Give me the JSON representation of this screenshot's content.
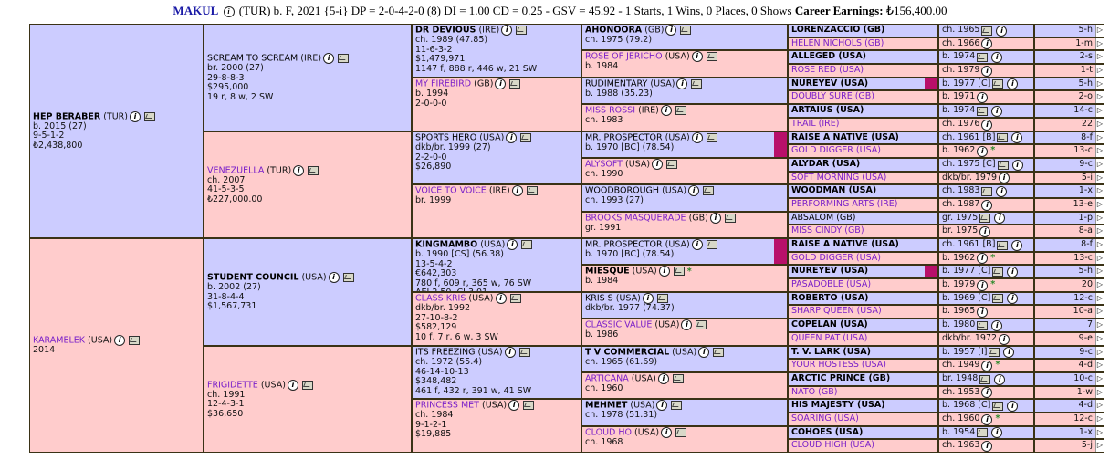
{
  "header": {
    "name": "MAKUL",
    "info": "(TUR) b. F, 2021 {5-i} DP = 2-0-4-2-0 (8) DI = 1.00  CD = 0.25 - GSV = 45.92 - 1 Starts, 1 Wins, 0 Places, 0 Shows",
    "earn_label": "Career Earnings:",
    "earn_value": "₺156,400.00"
  },
  "gen1": [
    {
      "name": "HEP BERABER",
      "suffix": "(TUR)",
      "lines": [
        "b. 2015 (27)",
        "9-5-1-2",
        "₺2,438,800"
      ],
      "sex": "male",
      "bold": true
    },
    {
      "name": "KARAMELEK",
      "suffix": "(USA)",
      "lines": [
        "2014"
      ],
      "sex": "female",
      "bold": false
    }
  ],
  "gen2": [
    {
      "name": "SCREAM TO SCREAM",
      "suffix": "(IRE)",
      "lines": [
        "br. 2000 (27)",
        "29-8-8-3",
        "$295,000",
        "19 r, 8 w, 2 SW"
      ],
      "sex": "male",
      "bold": false
    },
    {
      "name": "VENEZUELLA",
      "suffix": "(TUR)",
      "lines": [
        "ch. 2007",
        "41-5-3-5",
        "₺227,000.00"
      ],
      "sex": "female",
      "bold": false
    },
    {
      "name": "STUDENT COUNCIL",
      "suffix": "(USA)",
      "lines": [
        "b. 2002 (27)",
        "31-8-4-4",
        "$1,567,731"
      ],
      "sex": "male",
      "bold": true
    },
    {
      "name": "FRIGIDETTE",
      "suffix": "(USA)",
      "lines": [
        "ch. 1991",
        "12-4-3-1",
        "$36,650"
      ],
      "sex": "female",
      "bold": false
    }
  ],
  "gen3": [
    {
      "name": "DR DEVIOUS",
      "suffix": "(IRE)",
      "lines": [
        "ch. 1989 (47.85)",
        "11-6-3-2",
        "$1,479,971",
        "1147 f, 888 r, 446 w, 21 SW"
      ],
      "sex": "male",
      "bold": true
    },
    {
      "name": "MY FIREBIRD",
      "suffix": "(GB)",
      "lines": [
        "b. 1994",
        "2-0-0-0"
      ],
      "sex": "female",
      "bold": false
    },
    {
      "name": "SPORTS HERO",
      "suffix": "(USA)",
      "lines": [
        "dkb/br. 1999 (27)",
        "2-2-0-0",
        "$26,890"
      ],
      "sex": "male",
      "bold": false
    },
    {
      "name": "VOICE TO VOICE",
      "suffix": "(IRE)",
      "lines": [
        "br. 1999"
      ],
      "sex": "female",
      "bold": false
    },
    {
      "name": "KINGMAMBO",
      "suffix": "(USA)",
      "lines": [
        "b. 1990 [CS] (56.38)",
        "13-5-4-2",
        "€642,303",
        "780 f, 609 r, 365 w, 76 SW",
        "AEI 2.50, CI 3.01"
      ],
      "sex": "male",
      "bold": true
    },
    {
      "name": "CLASS KRIS",
      "suffix": "(USA)",
      "lines": [
        "dkb/br. 1992",
        "27-10-8-2",
        "$582,129",
        "10 f, 7 r, 6 w, 3 SW"
      ],
      "sex": "female",
      "bold": false
    },
    {
      "name": "ITS FREEZING",
      "suffix": "(USA)",
      "lines": [
        "ch. 1972 (55.4)",
        "46-14-10-13",
        "$348,482",
        "461 f, 432 r, 391 w, 41 SW"
      ],
      "sex": "male",
      "bold": false
    },
    {
      "name": "PRINCESS MET",
      "suffix": "(USA)",
      "lines": [
        "ch. 1984",
        "9-1-2-1",
        "$19,885"
      ],
      "sex": "female",
      "bold": false
    }
  ],
  "gen4": [
    {
      "name": "AHONOORA",
      "suffix": "(GB)",
      "lines": [
        "ch. 1975 (79.2)"
      ],
      "sex": "male",
      "bold": true
    },
    {
      "name": "ROSE OF JERICHO",
      "suffix": "(USA)",
      "lines": [
        "b. 1984"
      ],
      "sex": "female",
      "bold": false
    },
    {
      "name": "RUDIMENTARY",
      "suffix": "(USA)",
      "lines": [
        "b. 1988 (35.23)"
      ],
      "sex": "male",
      "bold": false
    },
    {
      "name": "MISS ROSSI",
      "suffix": "(IRE)",
      "lines": [
        "ch. 1983"
      ],
      "sex": "female",
      "bold": false
    },
    {
      "name": "MR. PROSPECTOR",
      "suffix": "(USA)",
      "lines": [
        "b. 1970 [BC] (78.54)"
      ],
      "sex": "male",
      "bold": false
    },
    {
      "name": "ALYSOFT",
      "suffix": "(USA)",
      "lines": [
        "ch. 1990"
      ],
      "sex": "female",
      "bold": false
    },
    {
      "name": "WOODBOROUGH",
      "suffix": "(USA)",
      "lines": [
        "ch. 1993 (27)"
      ],
      "sex": "male",
      "bold": false
    },
    {
      "name": "BROOKS MASQUERADE",
      "suffix": "(GB)",
      "lines": [
        "gr. 1991"
      ],
      "sex": "female",
      "bold": false
    },
    {
      "name": "MR. PROSPECTOR",
      "suffix": "(USA)",
      "lines": [
        "b. 1970 [BC] (78.54)"
      ],
      "sex": "male",
      "bold": false
    },
    {
      "name": "MIESQUE",
      "suffix": "(USA)",
      "lines": [
        "b. 1984"
      ],
      "sex": "female",
      "bold": true
    },
    {
      "name": "KRIS S",
      "suffix": "(USA)",
      "lines": [
        "dkb/br. 1977 (74.37)"
      ],
      "sex": "male",
      "bold": false
    },
    {
      "name": "CLASSIC VALUE",
      "suffix": "(USA)",
      "lines": [
        "b. 1986"
      ],
      "sex": "female",
      "bold": false
    },
    {
      "name": "T V COMMERCIAL",
      "suffix": "(USA)",
      "lines": [
        "ch. 1965 (61.69)"
      ],
      "sex": "male",
      "bold": true
    },
    {
      "name": "ARTICANA",
      "suffix": "(USA)",
      "lines": [
        "ch. 1960"
      ],
      "sex": "female",
      "bold": false
    },
    {
      "name": "MEHMET",
      "suffix": "(USA)",
      "lines": [
        "ch. 1978 (51.31)"
      ],
      "sex": "male",
      "bold": true
    },
    {
      "name": "CLOUD HO",
      "suffix": "(USA)",
      "lines": [
        "ch. 1968"
      ],
      "sex": "female",
      "bold": false
    }
  ],
  "gen5": [
    {
      "name": "LORENZACCIO (GB)",
      "sex": "male",
      "bold": true,
      "info": "ch. 1965",
      "dosage": "5-h"
    },
    {
      "name": "HELEN NICHOLS (GB)",
      "sex": "female",
      "bold": false,
      "info": "ch. 1966",
      "dosage": "1-m"
    },
    {
      "name": "ALLEGED (USA)",
      "sex": "male",
      "bold": true,
      "info": "b. 1974",
      "dosage": "2-s"
    },
    {
      "name": "ROSE RED (USA)",
      "sex": "female",
      "bold": false,
      "info": "ch. 1979",
      "dosage": "1-t"
    },
    {
      "name": "NUREYEV (USA)",
      "sex": "male",
      "bold": true,
      "info": "b. 1977 [C]",
      "dosage": "5-h"
    },
    {
      "name": "DOUBLY SURE (GB)",
      "sex": "female",
      "bold": false,
      "info": "b. 1971",
      "dosage": "2-o"
    },
    {
      "name": "ARTAIUS (USA)",
      "sex": "male",
      "bold": true,
      "info": "b. 1974",
      "dosage": "14-c"
    },
    {
      "name": "TRAIL (IRE)",
      "sex": "female",
      "bold": false,
      "info": "ch. 1976",
      "dosage": "22"
    },
    {
      "name": "RAISE A NATIVE (USA)",
      "sex": "male",
      "bold": true,
      "info": "ch. 1961 [B]",
      "dosage": "8-f"
    },
    {
      "name": "GOLD DIGGER (USA)",
      "sex": "female",
      "bold": false,
      "info": "b. 1962",
      "dosage": "13-c"
    },
    {
      "name": "ALYDAR (USA)",
      "sex": "male",
      "bold": true,
      "info": "ch. 1975 [C]",
      "dosage": "9-c"
    },
    {
      "name": "SOFT MORNING (USA)",
      "sex": "female",
      "bold": false,
      "info": "dkb/br. 1979",
      "dosage": "5-i"
    },
    {
      "name": "WOODMAN (USA)",
      "sex": "male",
      "bold": true,
      "info": "ch. 1983",
      "dosage": "1-x"
    },
    {
      "name": "PERFORMING ARTS (IRE)",
      "sex": "female",
      "bold": false,
      "info": "ch. 1987",
      "dosage": "13-e"
    },
    {
      "name": "ABSALOM (GB)",
      "sex": "male",
      "bold": false,
      "info": "gr. 1975",
      "dosage": "1-p"
    },
    {
      "name": "MISS CINDY (GB)",
      "sex": "female",
      "bold": false,
      "info": "br. 1975",
      "dosage": "8-a"
    },
    {
      "name": "RAISE A NATIVE (USA)",
      "sex": "male",
      "bold": true,
      "info": "ch. 1961 [B]",
      "dosage": "8-f"
    },
    {
      "name": "GOLD DIGGER (USA)",
      "sex": "female",
      "bold": false,
      "info": "b. 1962",
      "dosage": "13-c"
    },
    {
      "name": "NUREYEV (USA)",
      "sex": "male",
      "bold": true,
      "info": "b. 1977 [C]",
      "dosage": "5-h",
      "tall": true
    },
    {
      "name": "PASADOBLE (USA)",
      "sex": "female",
      "bold": false,
      "info": "b. 1979",
      "dosage": "20"
    },
    {
      "name": "ROBERTO (USA)",
      "sex": "male",
      "bold": true,
      "info": "b. 1969 [C]",
      "dosage": "12-c"
    },
    {
      "name": "SHARP QUEEN (USA)",
      "sex": "female",
      "bold": false,
      "info": "b. 1965",
      "dosage": "10-a"
    },
    {
      "name": "COPELAN (USA)",
      "sex": "male",
      "bold": true,
      "info": "b. 1980",
      "dosage": "7"
    },
    {
      "name": "QUEEN PAT (USA)",
      "sex": "female",
      "bold": false,
      "info": "dkb/br. 1972",
      "dosage": "9-e"
    },
    {
      "name": "T. V. LARK (USA)",
      "sex": "male",
      "bold": true,
      "info": "b. 1957 [I]",
      "dosage": "9-c"
    },
    {
      "name": "YOUR HOSTESS (USA)",
      "sex": "female",
      "bold": false,
      "info": "ch. 1949",
      "dosage": "4-d"
    },
    {
      "name": "ARCTIC PRINCE (GB)",
      "sex": "male",
      "bold": true,
      "info": "br. 1948",
      "dosage": "10-c"
    },
    {
      "name": "NATO (GB)",
      "sex": "female",
      "bold": false,
      "info": "ch. 1953",
      "dosage": "1-w"
    },
    {
      "name": "HIS MAJESTY (USA)",
      "sex": "male",
      "bold": true,
      "info": "b. 1968 [C]",
      "dosage": "4-d"
    },
    {
      "name": "SOARING (USA)",
      "sex": "female",
      "bold": false,
      "info": "ch. 1960",
      "dosage": "12-c"
    },
    {
      "name": "COHOES (USA)",
      "sex": "male",
      "bold": true,
      "info": "b. 1954",
      "dosage": "1-x"
    },
    {
      "name": "CLOUD HIGH (USA)",
      "sex": "female",
      "bold": false,
      "info": "ch. 1963",
      "dosage": "5-j"
    }
  ],
  "colors": {
    "male": "#ccccff",
    "female": "#ffcccc",
    "grid": "#4a3f1a",
    "highlight": "#b8106a",
    "star": "#2a8a2a",
    "female_name": "#7a1fc9"
  },
  "icons": {
    "info": "info-circle-icon",
    "media": "video-icon",
    "arrow": "triangle-right-icon",
    "star": "star-icon"
  }
}
